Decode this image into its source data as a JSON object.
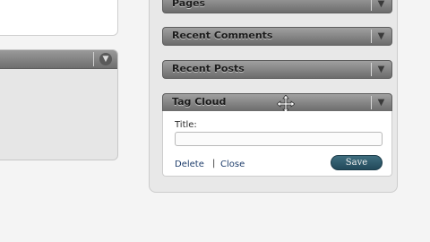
{
  "widgets": {
    "pages": {
      "title": "Pages"
    },
    "recent_comments": {
      "title": "Recent Comments"
    },
    "recent_posts": {
      "title": "Recent Posts"
    },
    "tag_cloud": {
      "title": "Tag Cloud",
      "form": {
        "title_label": "Title:",
        "title_value": "",
        "delete_label": "Delete",
        "separator": "|",
        "close_label": "Close",
        "save_label": "Save"
      }
    }
  },
  "icons": {
    "toggle": "chevron-down-icon",
    "move": "move-icon"
  },
  "colors": {
    "bar_dark": "#6c6c6c",
    "bar_light": "#a0a0a0",
    "save_button": "#2f5c6e",
    "link": "#1e3d6b"
  }
}
